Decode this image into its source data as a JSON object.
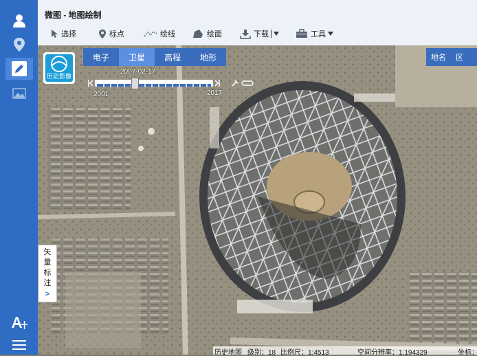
{
  "app": {
    "title": "微图 - 地图绘制"
  },
  "toolbar": {
    "select": "选择",
    "marker": "标点",
    "polyline": "绘线",
    "polygon": "绘面",
    "download": "下载",
    "tools": "工具"
  },
  "map_tabs": [
    "电子",
    "卫星",
    "高程",
    "地形"
  ],
  "map_tabs_active": "卫星",
  "right_layers": [
    "地名",
    "区"
  ],
  "history_badge": "历史影像",
  "timeline": {
    "date": "2007-02-17",
    "start": "2001",
    "end": "2017",
    "position": 0.33
  },
  "vector_tab": {
    "chars": [
      "矢",
      "量",
      "标",
      "注"
    ],
    "arrow": ">"
  },
  "status": {
    "layer": "历史地图",
    "level": "级别：18",
    "scale": "比例尺：1:4513",
    "resolution": "空间分辨率：1.194329",
    "coord": "坐标："
  },
  "colors": {
    "sidebar": "#2f6cc4",
    "tab_bar": "#3a6dbd",
    "tab_active": "#5b8fe0",
    "badge": "#1b9dd8"
  },
  "icons": [
    "user-icon",
    "location-icon",
    "pencil-icon",
    "image-icon",
    "text-style-icon",
    "menu-icon"
  ]
}
